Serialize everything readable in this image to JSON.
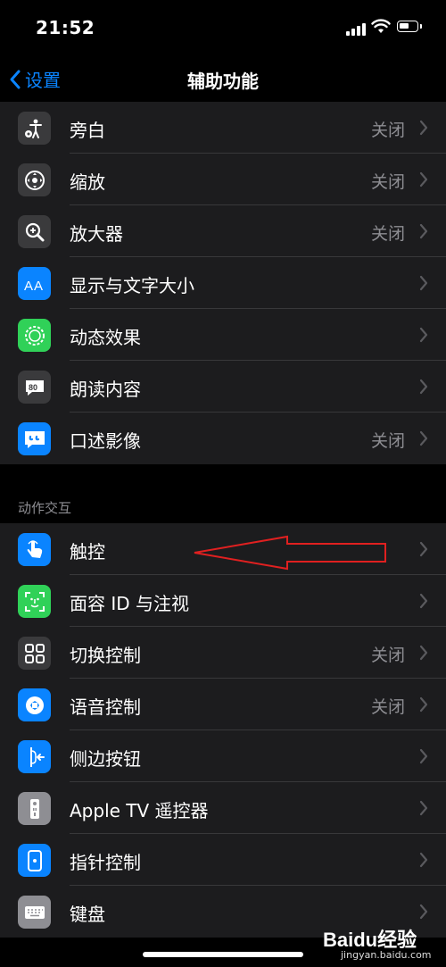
{
  "status_bar": {
    "time": "21:52"
  },
  "nav": {
    "back_label": "设置",
    "title": "辅助功能"
  },
  "group1": [
    {
      "label": "旁白",
      "value": "关闭",
      "icon": "voiceover-icon",
      "color": "#3a3a3c"
    },
    {
      "label": "缩放",
      "value": "关闭",
      "icon": "zoom-icon",
      "color": "#3a3a3c"
    },
    {
      "label": "放大器",
      "value": "关闭",
      "icon": "magnifier-icon",
      "color": "#3a3a3c"
    },
    {
      "label": "显示与文字大小",
      "value": "",
      "icon": "text-size-icon",
      "color": "#0a84ff"
    },
    {
      "label": "动态效果",
      "value": "",
      "icon": "motion-icon",
      "color": "#30d158"
    },
    {
      "label": "朗读内容",
      "value": "",
      "icon": "spoken-content-icon",
      "color": "#3a3a3c"
    },
    {
      "label": "口述影像",
      "value": "关闭",
      "icon": "audio-descriptions-icon",
      "color": "#0a84ff"
    }
  ],
  "section_header": "动作交互",
  "group2": [
    {
      "label": "触控",
      "value": "",
      "icon": "touch-icon",
      "color": "#0a84ff"
    },
    {
      "label": "面容 ID 与注视",
      "value": "",
      "icon": "face-id-icon",
      "color": "#30d158"
    },
    {
      "label": "切换控制",
      "value": "关闭",
      "icon": "switch-control-icon",
      "color": "#3a3a3c"
    },
    {
      "label": "语音控制",
      "value": "关闭",
      "icon": "voice-control-icon",
      "color": "#0a84ff"
    },
    {
      "label": "侧边按钮",
      "value": "",
      "icon": "side-button-icon",
      "color": "#0a84ff"
    },
    {
      "label": "Apple TV 遥控器",
      "value": "",
      "icon": "apple-tv-remote-icon",
      "color": "#8e8e93"
    },
    {
      "label": "指针控制",
      "value": "",
      "icon": "pointer-control-icon",
      "color": "#0a84ff"
    },
    {
      "label": "键盘",
      "value": "",
      "icon": "keyboard-icon",
      "color": "#8e8e93"
    }
  ],
  "watermark": {
    "brand": "Baidu经验",
    "url": "jingyan.baidu.com"
  },
  "annotation": {
    "arrow_color": "#e02020"
  }
}
